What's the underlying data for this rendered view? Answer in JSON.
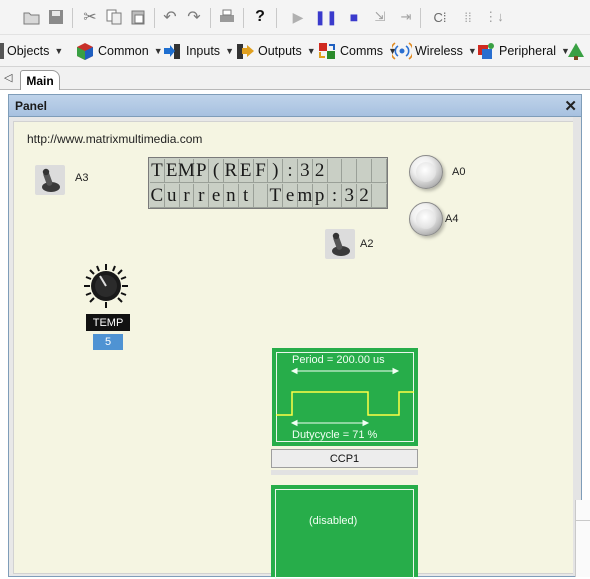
{
  "toolbar": {
    "icons": [
      "open-icon",
      "save-icon",
      "cut-icon",
      "copy-icon",
      "paste-icon",
      "undo-icon",
      "redo-icon",
      "print-icon",
      "help-icon",
      "run-icon",
      "pause-icon",
      "stop-icon",
      "step-into-icon",
      "step-over-icon",
      "chip-icon",
      "settings-icon",
      "build-icon"
    ]
  },
  "components_bar": {
    "items": [
      {
        "label": "Objects"
      },
      {
        "label": "Common"
      },
      {
        "label": "Inputs"
      },
      {
        "label": "Outputs"
      },
      {
        "label": "Comms"
      },
      {
        "label": "Wireless"
      },
      {
        "label": "Peripheral"
      }
    ]
  },
  "tabs": {
    "main_label": "Main"
  },
  "panel": {
    "title": "Panel",
    "url": "http://www.matrixmultimedia.com",
    "lcd": {
      "line1": "TEMP(REF):32",
      "line2": "Current Temp:32",
      "columns": 16
    },
    "switches": [
      {
        "label": "A3"
      },
      {
        "label": "A2"
      }
    ],
    "buttons": [
      {
        "label": "A0"
      },
      {
        "label": "A4"
      }
    ],
    "knob": {
      "label": "TEMP",
      "value": "5"
    },
    "scope": {
      "period": "Period = 200.00 us",
      "duty": "Dutycycle = 71 %",
      "name": "CCP1"
    },
    "disabled_text": "(disabled)"
  },
  "colors": {
    "scope_green": "#27ad4a",
    "wave_yellow": "#ffff44",
    "canvas": "#f5f5e2",
    "titlebar": "#a7c1e0",
    "knob_value_bg": "#4f93d3"
  }
}
